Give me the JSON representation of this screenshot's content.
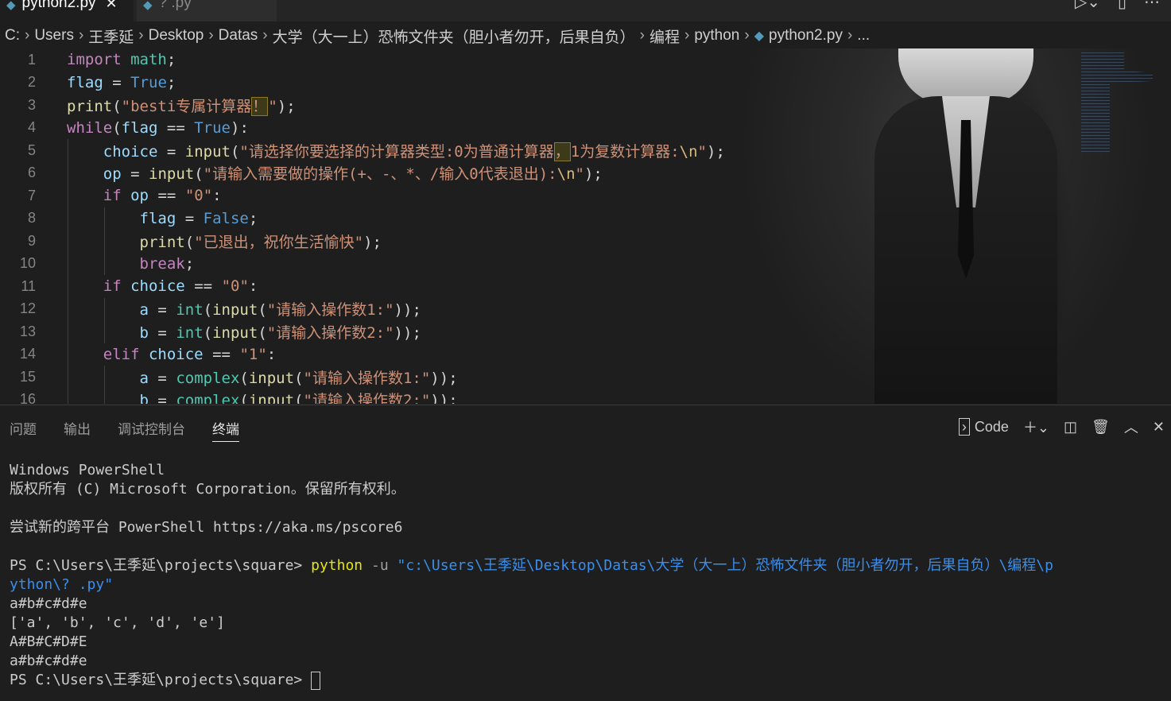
{
  "tabs": [
    {
      "label": "python2.py",
      "icon": "python-icon",
      "active": true
    },
    {
      "label": "? .py",
      "icon": "python-icon",
      "active": false
    }
  ],
  "breadcrumb": [
    "C:",
    "Users",
    "王季延",
    "Desktop",
    "Datas",
    "大学（大一上）恐怖文件夹（胆小者勿开，后果自负）",
    "编程",
    "python",
    "python2.py",
    "..."
  ],
  "editor": {
    "line_numbers": [
      "1",
      "2",
      "3",
      "4",
      "5",
      "6",
      "7",
      "8",
      "9",
      "10",
      "11",
      "12",
      "13",
      "14",
      "15",
      "16"
    ],
    "lines": [
      "import math;",
      "flag = True;",
      "print(\"besti专属计算器！\");",
      "while(flag == True):",
      "    choice = input(\"请选择你要选择的计算器类型:0为普通计算器，1为复数计算器:\\n\");",
      "    op = input(\"请输入需要做的操作(+、-、*、/输入0代表退出):\\n\");",
      "    if op == \"0\":",
      "        flag = False;",
      "        print(\"已退出，祝你生活愉快\");",
      "        break;",
      "    if choice == \"0\":",
      "        a = int(input(\"请输入操作数1:\"));",
      "        b = int(input(\"请输入操作数2:\"));",
      "    elif choice == \"1\":",
      "        a = complex(input(\"请输入操作数1:\"));",
      "        b = complex(input(\"请输入操作数2:\"));"
    ]
  },
  "panel": {
    "tabs": [
      "问题",
      "输出",
      "调试控制台",
      "终端"
    ],
    "active_tab": "终端",
    "terminal_profile": "Code"
  },
  "terminal": {
    "header1": "Windows PowerShell",
    "header2": "版权所有 (C) Microsoft Corporation。保留所有权利。",
    "header3": "尝试新的跨平台 PowerShell https://aka.ms/pscore6",
    "prompt": "PS C:\\Users\\王季延\\projects\\square>",
    "command": "python",
    "flag": "-u",
    "path1": "\"c:\\Users\\王季延\\Desktop\\Datas\\大学（大一上）恐怖文件夹（胆小者勿开，后果自负）\\编程\\p",
    "path2": "ython\\? .py\"",
    "out1": "a#b#c#d#e",
    "out2": "['a', 'b', 'c', 'd', 'e']",
    "out3": "A#B#C#D#E",
    "out4": "a#b#c#d#e",
    "prompt2": "PS C:\\Users\\王季延\\projects\\square>"
  }
}
